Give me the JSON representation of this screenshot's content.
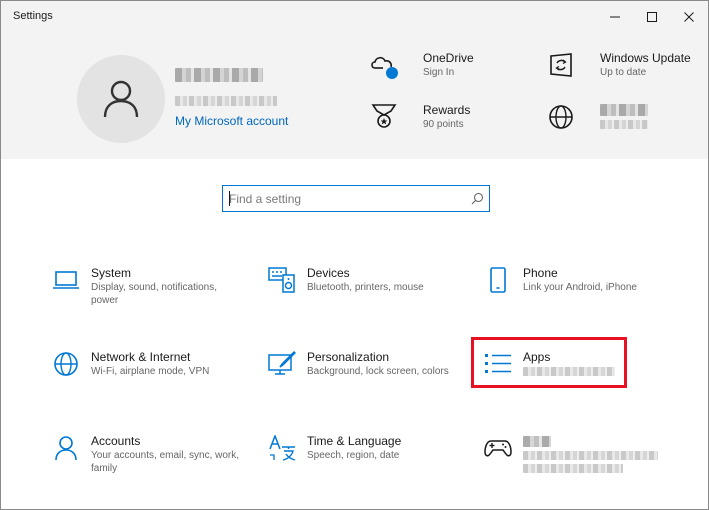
{
  "window": {
    "title": "Settings"
  },
  "account": {
    "link_label": "My Microsoft account"
  },
  "header_items": {
    "onedrive": {
      "title": "OneDrive",
      "subtitle": "Sign In"
    },
    "windows_update": {
      "title": "Windows Update",
      "subtitle": "Up to date"
    },
    "rewards": {
      "title": "Rewards",
      "subtitle": "90 points"
    }
  },
  "search": {
    "placeholder": "Find a setting"
  },
  "tiles": {
    "system": {
      "title": "System",
      "desc": "Display, sound, notifications, power"
    },
    "devices": {
      "title": "Devices",
      "desc": "Bluetooth, printers, mouse"
    },
    "phone": {
      "title": "Phone",
      "desc": "Link your Android, iPhone"
    },
    "network": {
      "title": "Network & Internet",
      "desc": "Wi-Fi, airplane mode, VPN"
    },
    "personalization": {
      "title": "Personalization",
      "desc": "Background, lock screen, colors"
    },
    "apps": {
      "title": "Apps"
    },
    "accounts": {
      "title": "Accounts",
      "desc": "Your accounts, email, sync, work, family"
    },
    "time_language": {
      "title": "Time & Language",
      "desc": "Speech, region, date"
    }
  },
  "colors": {
    "accent": "#0078d4",
    "highlight": "#e81123",
    "header_bg": "#f3f3f3"
  }
}
